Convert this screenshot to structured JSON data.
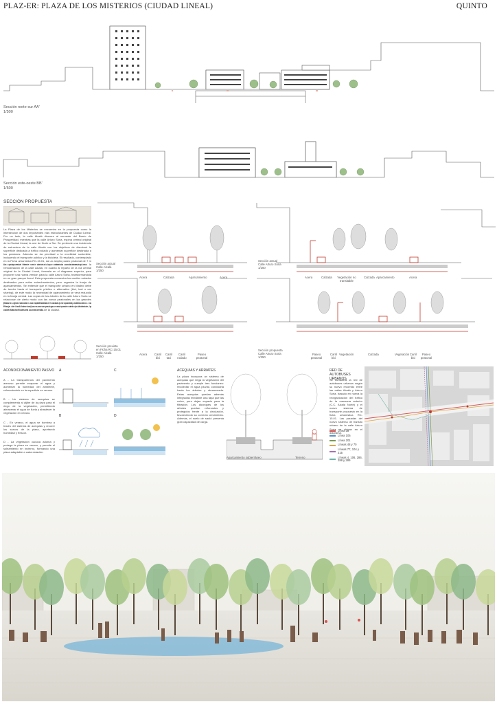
{
  "header": {
    "title": "PLAZ-ER: PLAZA DE LOS MISTERIOS (CIUDAD LINEAL)",
    "team": "QUINTO"
  },
  "section_aa": {
    "title": "Sección norte-sur AA'",
    "scale": "1/500"
  },
  "section_bb": {
    "title": "Sección este-oeste BB'",
    "scale": "1/500"
  },
  "proposal": {
    "heading": "SECCIÓN PROPUESTA",
    "paragraph1": "La Plaza de los Misterios se encuentra en la propuesta como la intersección de dos importantes vías estructurantes de Ciudad Lineal. Por un lado, la calle Alcalá discurre al suroeste del Barrio de Prosperidad, mientras que la calle Arturo Soria, espina central original de la Ciudad Lineal, la une de Norte a Sur. Se pretende una incidencia de estructura de la calle Alcalá con los objetivos de disminuir la superficie dedicada a tráfico rodado y aumentar superficie destinada a los peatones. Además se da prioridad a la movilidad sostenible, incluyendo el transporte público y la bicicleta. El resultado, contemplado en la Ficha urbanística RC-15.01, da un amplio paseo peatonal de 7 m de ancho en el frente norte de la vía que conecta con la nueva plaza.",
    "paragraph2": "La propuesta tiene en cuenta los criterios considerados en la remodelación de la calle Alcalá, en cuanto al reparto de la vía central original de la Ciudad Lineal, formada en el diagrama superior, para proponer una nueva versión para la calle Arturo Soria, transformándola en un gran parque lineal. Esta propuesta concentra los carriles rodados destinados para evitar estrechamientos, pero organiza la franja de aparcamientos. Se entiende que el transporte urbano en Madrid debe de tender hacia el transporte público o alternativo (bici, taxi o car sharing), de este modo la necesidad de aparcamiento se verá reducida en la franja central. Las copas de los árboles de la calle Arturo Soria se relacionan de cierto modo con las zonas peatonales en las grandes plazas, generando una continuidad visual y espacial adecuada. La franja de las tres calles son espacios más para vivir y disfrutar, y conectan bien ahora con el resto de la ciudad.",
    "paragraph3": "Esta nueva sección complementa el arbolado correspondiente a la Plaza de los Misterios, para crear una gran extensión arbolada desde la calle Arturo Soria en su recorrido."
  },
  "sections": [
    {
      "caption": [
        "Sección actual",
        "Calle Alcalá",
        "1/250"
      ],
      "labels": [
        "Acera",
        "Calzada",
        "Aparcamiento",
        "Acera"
      ]
    },
    {
      "caption": [
        "Sección actual",
        "Calle Arturo Soria",
        "1/250"
      ],
      "labels": [
        "Acera",
        "Calzada",
        "Vegetación no transitable",
        "Calzada",
        "Aparcamiento",
        "Acera"
      ]
    },
    {
      "caption": [
        "Sección prevista",
        "en Ficha RC-15.01",
        "Calle Alcalá",
        "1/250"
      ],
      "labels": [
        "Acera",
        "Carril bici",
        "Carril taxi",
        "Carril rodado",
        "Paseo peatonal"
      ]
    },
    {
      "caption": [
        "Sección propuesta",
        "Calle Arturo Soria",
        "1/250"
      ],
      "labels": [
        "Paseo peatonal",
        "Carril bici",
        "Vegetación",
        "Calzada",
        "Vegetación",
        "Carril bici",
        "Paseo peatonal"
      ]
    }
  ],
  "conditioning": {
    "heading": "ACONDICIONAMIENTO PASIVO",
    "items": [
      "A - La transparencia del pavimento arenoso permite evaporar el agua y aumentar la humedad del ambiente, refrescándolo en la superficie en verano.",
      "B - Un sistema de acequias se complementa al aljibe de la plaza para el riego de la vegetación, permitiendo almacenar el agua de lluvia y abastecer la vegetación en verano.",
      "C - En verano, el agua se bombea a través del sistema de acequias y recorre los surcos de la plaza, aportando humedad y frescor.",
      "D - La vegetación caduca adorna y protege la plaza en verano, y permite el soleamiento en invierno, formando una plaza adaptable a cada estación."
    ],
    "diagram_letters": [
      "A",
      "C",
      "B",
      "D"
    ]
  },
  "acequias": {
    "heading": "ACEQUIAS Y ARRIATES",
    "text": "La plaza incorpora un sistema de acequias que riega la vegetación del pavimento y cumple tres funciones: recolectar el agua pluvial, conducirla hacia los árboles y almacenarla. Estas acequias quedan además integradas mediante una tapa que las cubre, pero dejan espacio para la filtración. Los alcorques de los árboles quedan reforzados y protegidos frente a la circulación, favoreciendo su correcto crecimiento. Además, el suelo de sauló presenta gran capacidad de carga.",
    "label_left": "Aparcamiento subterráneo",
    "label_right": "Terreno"
  },
  "transport": {
    "heading": "RED DE AUTOBUSES URBANOS",
    "text": "Se considera la red de autobuses urbanos según su nuevo recorrido entre las calles Alcalá y Arturo Soria, basado en nueva la reorganización del tráfico de la manzana anterior (C.C. Alcalá Norte) y el nuevo sistema de transporte propuesto en la ficha urbanística RC-15.01. Las paradas del nuevo sistema de tránsito urbano de la calle Arturo Soria se ubican en el diagrama.",
    "legend": [
      {
        "label": "Línea 38",
        "color": "#d9534f"
      },
      {
        "label": "Línea 105",
        "color": "#5b8fc7"
      },
      {
        "label": "Línea 201",
        "color": "#7a9a4f"
      },
      {
        "label": "Líneas 48 y 70",
        "color": "#e0a640"
      },
      {
        "label": "Líneas 77, 104 y 215",
        "color": "#a86fb0"
      },
      {
        "label": "Líneas 4, 106, 286, 288 y 289",
        "color": "#6fb3a8"
      }
    ]
  }
}
